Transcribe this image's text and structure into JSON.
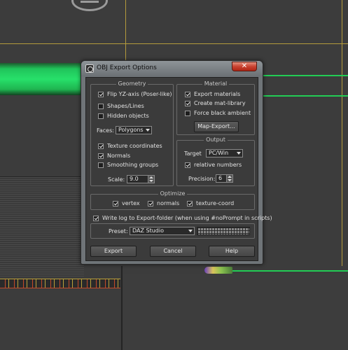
{
  "dialog": {
    "title": "OBJ Export Options",
    "close_label": "✕"
  },
  "geometry": {
    "title": "Geometry",
    "flip_yz": {
      "label": "Flip YZ-axis (Poser-like)",
      "checked": true
    },
    "shapes_lines": {
      "label": "Shapes/Lines",
      "checked": false
    },
    "hidden_objects": {
      "label": "Hidden objects",
      "checked": false
    },
    "faces_label": "Faces:",
    "faces_value": "Polygons",
    "texture_coordinates": {
      "label": "Texture coordinates",
      "checked": true
    },
    "normals": {
      "label": "Normals",
      "checked": true
    },
    "smoothing_groups": {
      "label": "Smoothing groups",
      "checked": false
    },
    "scale_label": "Scale:",
    "scale_value": "9.0"
  },
  "material": {
    "title": "Material",
    "export_materials": {
      "label": "Export materials",
      "checked": true
    },
    "create_mat_library": {
      "label": "Create mat-library",
      "checked": true
    },
    "force_black_ambient": {
      "label": "Force black ambient",
      "checked": false
    },
    "map_export_label": "Map-Export..."
  },
  "output": {
    "title": "Output",
    "target_label": "Target",
    "target_value": "PC/Win",
    "relative_numbers": {
      "label": "relative numbers",
      "checked": true
    },
    "precision_label": "Precision:",
    "precision_value": "6"
  },
  "optimize": {
    "title": "Optimize",
    "vertex": {
      "label": "vertex",
      "checked": true
    },
    "normals": {
      "label": "normals",
      "checked": true
    },
    "texture_coord": {
      "label": "texture-coord",
      "checked": true
    }
  },
  "write_log": {
    "label": "Write log to Export-folder (when using #noPrompt in scripts)",
    "checked": true
  },
  "preset": {
    "label": "Preset:",
    "value": "DAZ Studio"
  },
  "buttons": {
    "export": "Export",
    "cancel": "Cancel",
    "help": "Help"
  }
}
